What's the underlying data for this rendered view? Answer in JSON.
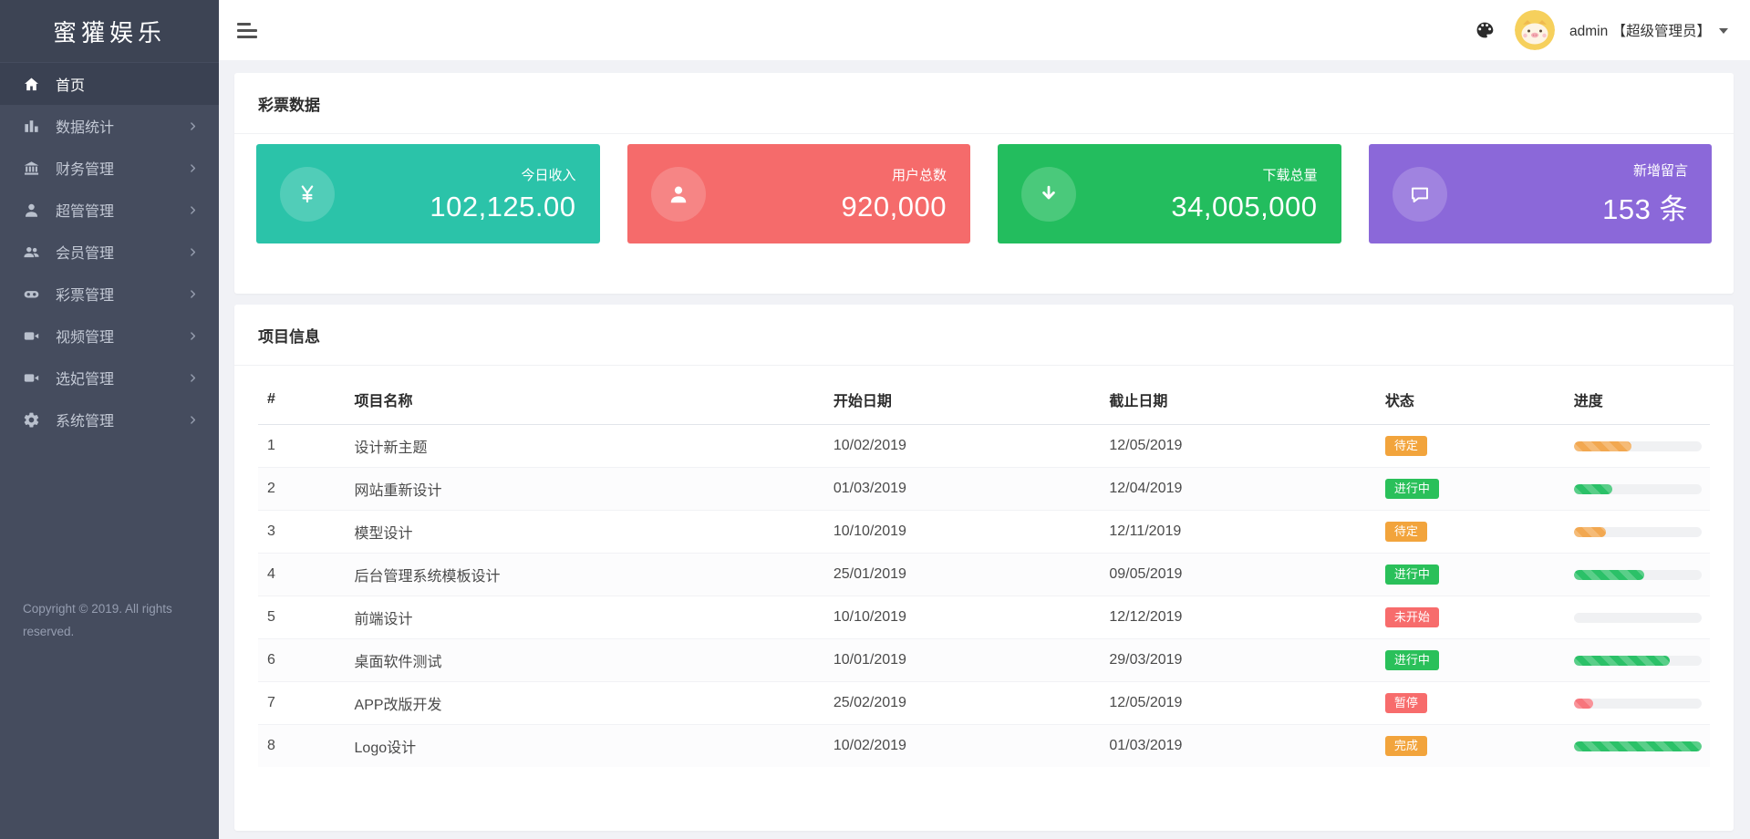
{
  "sidebar": {
    "logo": "蜜獾娱乐",
    "copyright_line1": "Copyright © 2019. All rights",
    "copyright_line2": "reserved.",
    "items": [
      {
        "label": "首页",
        "icon": "home-icon",
        "state": "active",
        "chevron": ""
      },
      {
        "label": "数据统计",
        "icon": "bar-chart-icon",
        "state": "",
        "chevron": "chevron-right-icon"
      },
      {
        "label": "财务管理",
        "icon": "bank-icon",
        "state": "",
        "chevron": "chevron-right-icon"
      },
      {
        "label": "超管管理",
        "icon": "user-icon",
        "state": "",
        "chevron": "chevron-right-icon"
      },
      {
        "label": "会员管理",
        "icon": "users-icon",
        "state": "",
        "chevron": "chevron-right-icon"
      },
      {
        "label": "彩票管理",
        "icon": "gamepad-icon",
        "state": "",
        "chevron": "chevron-right-icon"
      },
      {
        "label": "视频管理",
        "icon": "video-icon",
        "state": "",
        "chevron": "chevron-right-icon"
      },
      {
        "label": "选妃管理",
        "icon": "video-icon",
        "state": "",
        "chevron": "chevron-right-icon"
      },
      {
        "label": "系统管理",
        "icon": "gear-icon",
        "state": "",
        "chevron": "chevron-right-icon"
      }
    ]
  },
  "header": {
    "username": "admin 【超级管理员】"
  },
  "stats_panel": {
    "title": "彩票数据",
    "cards": [
      {
        "label": "今日收入",
        "value": "102,125.00",
        "bg": "#2bc3a9",
        "icon": "yen-icon"
      },
      {
        "label": "用户总数",
        "value": "920,000",
        "bg": "#f56b6b",
        "icon": "person-icon"
      },
      {
        "label": "下载总量",
        "value": "34,005,000",
        "bg": "#23bd5e",
        "icon": "download-icon"
      },
      {
        "label": "新增留言",
        "value": "153 条",
        "bg": "#8b68d9",
        "icon": "message-icon"
      }
    ]
  },
  "projects_panel": {
    "title": "项目信息",
    "columns": {
      "num": "#",
      "name": "项目名称",
      "start": "开始日期",
      "end": "截止日期",
      "status": "状态",
      "progress": "进度"
    },
    "rows": [
      {
        "num": "1",
        "name": "设计新主题",
        "start": "10/02/2019",
        "end": "12/05/2019",
        "status": "待定",
        "status_color": "orange",
        "progress": "45%",
        "progress_color": "orange"
      },
      {
        "num": "2",
        "name": "网站重新设计",
        "start": "01/03/2019",
        "end": "12/04/2019",
        "status": "进行中",
        "status_color": "green",
        "progress": "30%",
        "progress_color": "green"
      },
      {
        "num": "3",
        "name": "模型设计",
        "start": "10/10/2019",
        "end": "12/11/2019",
        "status": "待定",
        "status_color": "orange",
        "progress": "25%",
        "progress_color": "orange"
      },
      {
        "num": "4",
        "name": "后台管理系统模板设计",
        "start": "25/01/2019",
        "end": "09/05/2019",
        "status": "进行中",
        "status_color": "green",
        "progress": "55%",
        "progress_color": "green"
      },
      {
        "num": "5",
        "name": "前端设计",
        "start": "10/10/2019",
        "end": "12/12/2019",
        "status": "未开始",
        "status_color": "red",
        "progress": "0%",
        "progress_color": "green"
      },
      {
        "num": "6",
        "name": "桌面软件测试",
        "start": "10/01/2019",
        "end": "29/03/2019",
        "status": "进行中",
        "status_color": "green",
        "progress": "75%",
        "progress_color": "green"
      },
      {
        "num": "7",
        "name": "APP改版开发",
        "start": "25/02/2019",
        "end": "12/05/2019",
        "status": "暂停",
        "status_color": "red",
        "progress": "15%",
        "progress_color": "red"
      },
      {
        "num": "8",
        "name": "Logo设计",
        "start": "10/02/2019",
        "end": "01/03/2019",
        "status": "完成",
        "status_color": "orange",
        "progress": "100%",
        "progress_color": "green"
      }
    ]
  }
}
